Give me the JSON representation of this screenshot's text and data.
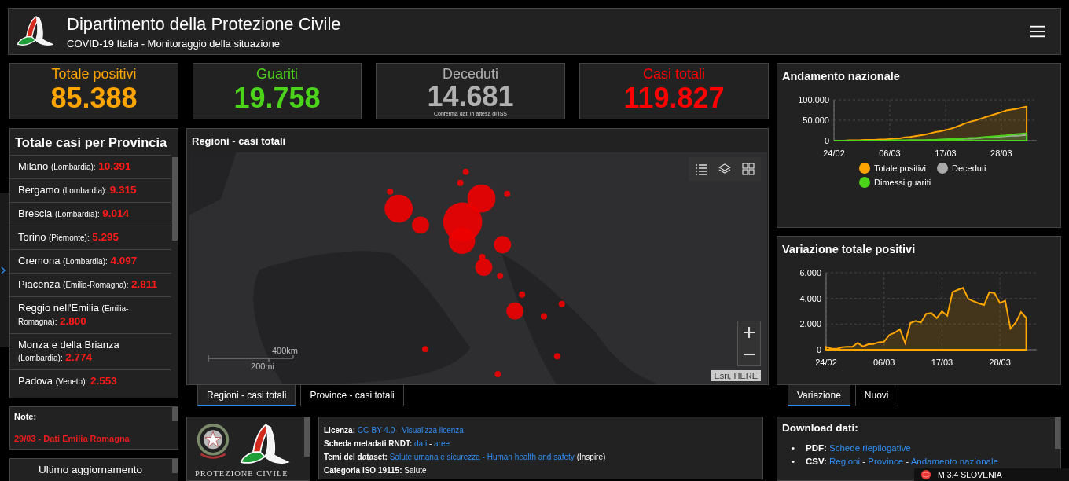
{
  "header": {
    "title": "Dipartimento della Protezione Civile",
    "subtitle": "COVID-19 Italia - Monitoraggio della situazione"
  },
  "stats": [
    {
      "label": "Totale positivi",
      "value": "85.388",
      "color": "#ffa500"
    },
    {
      "label": "Guariti",
      "value": "19.758",
      "color": "#4cd41b"
    },
    {
      "label": "Deceduti",
      "value": "14.681",
      "color": "#b0b0b0",
      "note": "Conferma dati in attesa di ISS"
    },
    {
      "label": "Casi totali",
      "value": "119.827",
      "color": "#ff0000"
    }
  ],
  "provinces": {
    "title": "Totale casi per Provincia",
    "items": [
      {
        "name": "Milano",
        "region": "(Lombardia):",
        "value": "10.391"
      },
      {
        "name": "Bergamo",
        "region": "(Lombardia):",
        "value": "9.315"
      },
      {
        "name": "Brescia",
        "region": "(Lombardia):",
        "value": "9.014"
      },
      {
        "name": "Torino",
        "region": "(Piemonte):",
        "value": "5.295"
      },
      {
        "name": "Cremona",
        "region": "(Lombardia):",
        "value": "4.097"
      },
      {
        "name": "Piacenza",
        "region": "(Emilia-Romagna):",
        "value": "2.811"
      },
      {
        "name": "Reggio nell'Emilia",
        "region": "(Emilia-Romagna):",
        "value": "2.800"
      },
      {
        "name": "Monza e della Brianza",
        "region": "(Lombardia):",
        "value": "2.774"
      },
      {
        "name": "Padova",
        "region": "(Veneto):",
        "value": "2.553"
      }
    ]
  },
  "notes": {
    "title": "Note:",
    "items": [
      "29/03 - Dati Emilia Romagna"
    ]
  },
  "last_update": {
    "title": "Ultimo aggiornamento"
  },
  "map_panel": {
    "title": "Regioni - casi totali",
    "scale_km": "400km",
    "scale_mi": "200mi",
    "attribution": "Esri, HERE"
  },
  "map_tabs": [
    {
      "label": "Regioni - casi totali",
      "selected": true
    },
    {
      "label": "Province - casi totali",
      "selected": false
    }
  ],
  "logos": {
    "caption": "PROTEZIONE CIVILE"
  },
  "license": [
    {
      "label": "Licenza:",
      "parts": [
        {
          "text": "CC-BY-4.0",
          "link": true
        },
        {
          "text": "-",
          "link": false
        },
        {
          "text": "Visualizza licenza",
          "link": true
        }
      ]
    },
    {
      "label": "Scheda metadati RNDT:",
      "parts": [
        {
          "text": "dati",
          "link": true
        },
        {
          "text": "-",
          "link": false
        },
        {
          "text": "aree",
          "link": true
        }
      ]
    },
    {
      "label": "Temi del dataset:",
      "parts": [
        {
          "text": "Salute umana e sicurezza - Human health and safety",
          "link": true
        },
        {
          "text": "(Inspire)",
          "link": false
        }
      ]
    },
    {
      "label": "Categoria ISO 19115:",
      "parts": [
        {
          "text": "Salute",
          "link": false
        }
      ]
    }
  ],
  "national_chart": {
    "title": "Andamento nazionale",
    "chart_data": {
      "type": "area",
      "grid": true,
      "categories": [
        "24/02",
        null,
        null,
        null,
        null,
        null,
        null,
        null,
        null,
        null,
        null,
        "06/03",
        null,
        null,
        null,
        null,
        null,
        null,
        null,
        null,
        null,
        null,
        "17/03",
        null,
        null,
        null,
        null,
        null,
        null,
        null,
        null,
        null,
        null,
        "28/03",
        null,
        null,
        null,
        null,
        null
      ],
      "ylim": [
        0,
        100
      ],
      "yticks": [
        {
          "value": 0,
          "label": "0"
        },
        {
          "value": 50,
          "label": "50.000"
        },
        {
          "value": 100,
          "label": "100.000"
        }
      ],
      "series": [
        {
          "name": "Totale positivi",
          "color": "#ffa500",
          "values": [
            0,
            0,
            0,
            1,
            1,
            1,
            2,
            2,
            2,
            3,
            3,
            4,
            5,
            6,
            8,
            9,
            11,
            13,
            15,
            18,
            21,
            23,
            26,
            29,
            33,
            38,
            43,
            47,
            50,
            54,
            58,
            62,
            66,
            70,
            74,
            76,
            78,
            81,
            83
          ]
        },
        {
          "name": "Deceduti",
          "color": "#aaaaaa",
          "values": [
            0,
            0,
            0,
            0,
            0,
            0,
            0,
            0,
            0,
            0,
            0,
            0,
            0,
            0,
            0,
            1,
            1,
            1,
            1,
            1,
            2,
            2,
            3,
            3,
            3,
            4,
            5,
            5,
            6,
            7,
            8,
            8,
            9,
            10,
            11,
            12,
            12,
            13,
            14
          ]
        },
        {
          "name": "Dimessi guariti",
          "color": "#4cd41b",
          "values": [
            0,
            0,
            0,
            0,
            0,
            0,
            0,
            0,
            0,
            0,
            0,
            1,
            1,
            1,
            1,
            1,
            1,
            1,
            1,
            2,
            2,
            3,
            3,
            4,
            4,
            5,
            6,
            7,
            7,
            8,
            9,
            10,
            11,
            12,
            13,
            15,
            16,
            17,
            18
          ]
        }
      ]
    }
  },
  "variation_chart": {
    "title": "Variazione totale positivi",
    "chart_data": {
      "type": "area",
      "grid": true,
      "categories": [
        "24/02",
        null,
        null,
        null,
        null,
        null,
        null,
        null,
        null,
        null,
        null,
        "06/03",
        null,
        null,
        null,
        null,
        null,
        null,
        null,
        null,
        null,
        null,
        "17/03",
        null,
        null,
        null,
        null,
        null,
        null,
        null,
        null,
        null,
        null,
        "28/03",
        null,
        null,
        null,
        null,
        null
      ],
      "ylim": [
        0,
        6
      ],
      "yticks": [
        {
          "value": 0,
          "label": "0"
        },
        {
          "value": 2,
          "label": "2.000"
        },
        {
          "value": 4,
          "label": "4.000"
        },
        {
          "value": 6,
          "label": "6.000"
        }
      ],
      "series": [
        {
          "color": "#ffa500",
          "values": [
            0.22,
            0.09,
            0.07,
            0.2,
            0.23,
            0.23,
            0.53,
            0.26,
            0.43,
            0.44,
            0.59,
            0.62,
            1.15,
            1.33,
            1.6,
            0.53,
            2.08,
            2.25,
            2.12,
            2.8,
            2.85,
            2.47,
            2.99,
            2.65,
            4.48,
            4.67,
            4.82,
            3.96,
            3.78,
            3.61,
            3.49,
            4.49,
            4.4,
            3.65,
            3.82,
            1.65,
            2.11,
            2.94,
            2.48
          ]
        }
      ]
    }
  },
  "chart_tabs": [
    {
      "label": "Variazione",
      "selected": true
    },
    {
      "label": "Nuovi",
      "selected": false
    }
  ],
  "downloads": {
    "title": "Download dati:",
    "items": [
      {
        "marker": "•",
        "label": "PDF:",
        "parts": [
          {
            "text": "Schede riepilogative",
            "link": true
          }
        ]
      },
      {
        "marker": "•",
        "label": "CSV:",
        "parts": [
          {
            "text": "Regioni",
            "link": true
          },
          {
            "text": "-",
            "link": false
          },
          {
            "text": "Province",
            "link": true
          },
          {
            "text": "-",
            "link": false
          },
          {
            "text": "Andamento nazionale",
            "link": true
          }
        ]
      }
    ]
  },
  "toast": {
    "text": "M 3.4 SLOVENIA"
  }
}
